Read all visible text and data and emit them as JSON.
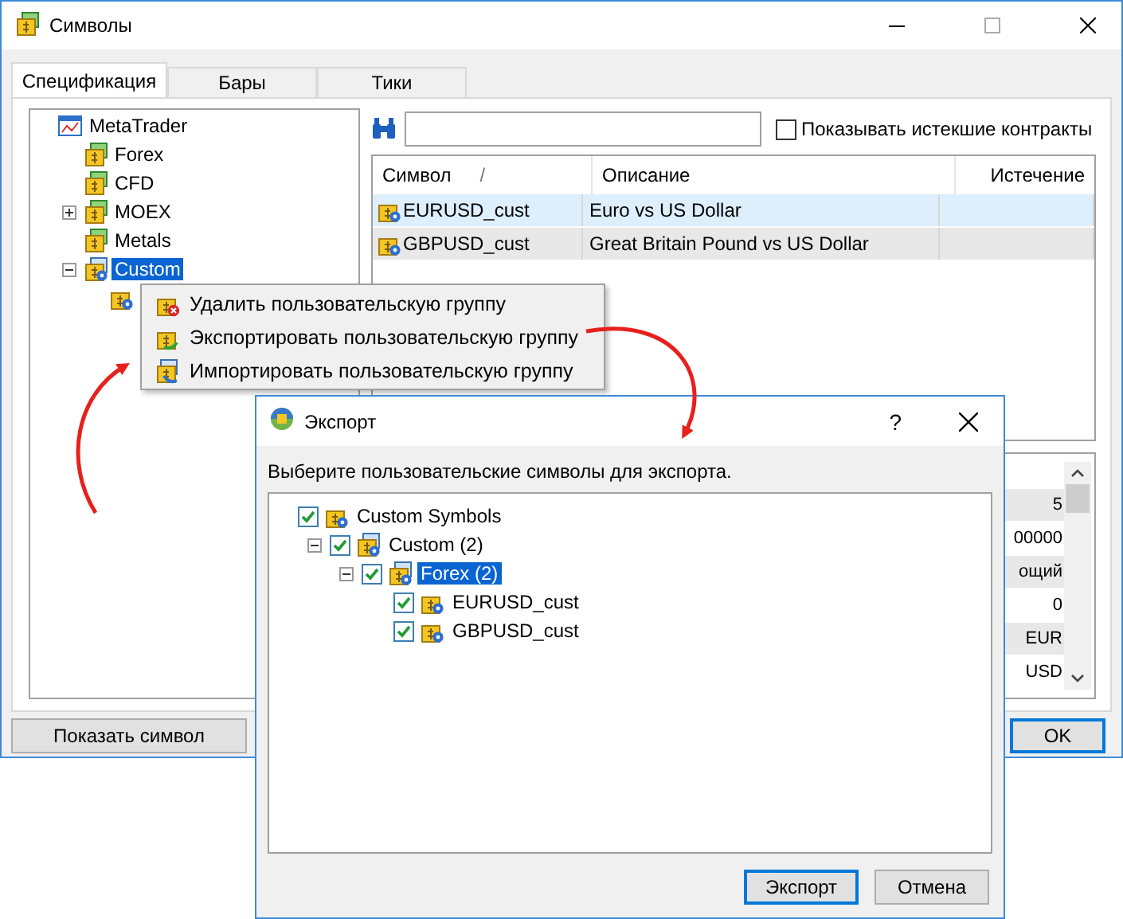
{
  "window": {
    "title": "Символы"
  },
  "tabs": [
    {
      "label": "Спецификация",
      "selected": true
    },
    {
      "label": "Бары",
      "selected": false
    },
    {
      "label": "Тики",
      "selected": false
    }
  ],
  "tree": [
    {
      "label": "MetaTrader",
      "kind": "root",
      "selected": false,
      "children": [
        {
          "label": "Forex",
          "kind": "group",
          "selected": false
        },
        {
          "label": "CFD",
          "kind": "group",
          "selected": false
        },
        {
          "label": "MOEX",
          "kind": "group",
          "expanded": false,
          "selected": false
        },
        {
          "label": "Metals",
          "kind": "group",
          "selected": false
        },
        {
          "label": "Custom",
          "kind": "custom",
          "expanded": true,
          "selected": true,
          "children": [
            {
              "kind": "custom"
            }
          ]
        }
      ]
    }
  ],
  "show_expired": {
    "label": "Показывать истекшие контракты",
    "checked": false
  },
  "table": {
    "columns": [
      {
        "label": "Символ",
        "sort_mark": "/"
      },
      {
        "label": "Описание"
      },
      {
        "label": "Истечение"
      }
    ],
    "rows": [
      {
        "symbol": "EURUSD_cust",
        "description": "Euro vs US Dollar",
        "selected": true
      },
      {
        "symbol": "GBPUSD_cust",
        "description": "Great Britain Pound vs US Dollar",
        "selected": false
      }
    ]
  },
  "details": {
    "values": [
      "5",
      "00000",
      "ощий",
      "0",
      "EUR",
      "USD"
    ]
  },
  "buttons": {
    "show_symbol": "Показать символ",
    "ok": "OK"
  },
  "context_menu": {
    "items": [
      {
        "label": "Удалить пользовательскую группу",
        "kind": "delete"
      },
      {
        "label": "Экспортировать пользовательскую группу",
        "kind": "export"
      },
      {
        "label": "Импортировать пользовательскую группу",
        "kind": "import"
      }
    ]
  },
  "export_dialog": {
    "title": "Экспорт",
    "help": "?",
    "prompt": "Выберите пользовательские символы для экспорта.",
    "tree": [
      {
        "label": "Custom Symbols",
        "checked": true,
        "selected": false,
        "children": [
          {
            "label": "Custom (2)",
            "checked": true,
            "expanded": true,
            "selected": false,
            "children": [
              {
                "label": "Forex (2)",
                "checked": true,
                "expanded": true,
                "selected": true,
                "children": [
                  {
                    "label": "EURUSD_cust",
                    "checked": true,
                    "selected": false
                  },
                  {
                    "label": "GBPUSD_cust",
                    "checked": true,
                    "selected": false
                  }
                ]
              }
            ]
          }
        ]
      }
    ],
    "buttons": [
      {
        "label": "Экспорт",
        "default": true
      },
      {
        "label": "Отмена",
        "default": false
      }
    ]
  }
}
